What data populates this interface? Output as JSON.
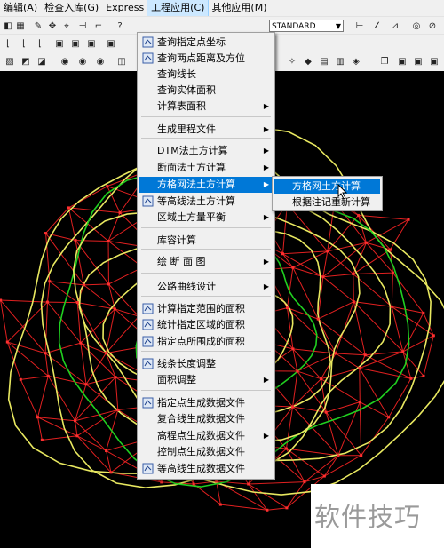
{
  "menubar": {
    "items": [
      "编辑(A)",
      "检查入库(G)",
      "Express",
      "工程应用(C)",
      "其他应用(M)"
    ]
  },
  "toolbar": {
    "style_combo_value": "STANDARD"
  },
  "menu": {
    "items": [
      {
        "label": "查询指定点坐标",
        "icon": "query-point-icon"
      },
      {
        "label": "查询两点距离及方位",
        "icon": "distance-icon"
      },
      {
        "label": "查询线长"
      },
      {
        "label": "查询实体面积"
      },
      {
        "label": "计算表面积",
        "submenu": true
      },
      {
        "label": "生成里程文件",
        "submenu": true
      },
      {
        "label": "DTM法土方计算",
        "submenu": true
      },
      {
        "label": "断面法土方计算",
        "submenu": true
      },
      {
        "label": "方格网法土方计算",
        "submenu": true,
        "highlighted": true
      },
      {
        "label": "等高线法土方计算",
        "icon": "contour-calc-icon"
      },
      {
        "label": "区域土方量平衡",
        "submenu": true
      },
      {
        "label": "库容计算"
      },
      {
        "label": "绘 断 面 图",
        "submenu": true
      },
      {
        "label": "公路曲线设计",
        "submenu": true
      },
      {
        "label": "计算指定范围的面积",
        "icon": "area-range-icon"
      },
      {
        "label": "统计指定区域的面积",
        "icon": "area-stat-icon"
      },
      {
        "label": "指定点所围成的面积",
        "icon": "area-points-icon"
      },
      {
        "label": "线条长度调整",
        "icon": "line-adjust-icon"
      },
      {
        "label": "面积调整",
        "submenu": true
      },
      {
        "label": "指定点生成数据文件",
        "icon": "point-data-icon"
      },
      {
        "label": "复合线生成数据文件"
      },
      {
        "label": "高程点生成数据文件",
        "submenu": true
      },
      {
        "label": "控制点生成数据文件"
      },
      {
        "label": "等高线生成数据文件",
        "icon": "contour-data-icon"
      }
    ]
  },
  "submenu": {
    "items": [
      {
        "label": "方格网土方计算",
        "highlighted": true
      },
      {
        "label": "根据注记重新计算"
      }
    ]
  },
  "watermark": "软件技巧",
  "colors": {
    "menu_highlight": "#0078d7",
    "tin_lines": "#e02020",
    "contour_yellow": "#e8e860",
    "contour_green": "#20d020"
  }
}
